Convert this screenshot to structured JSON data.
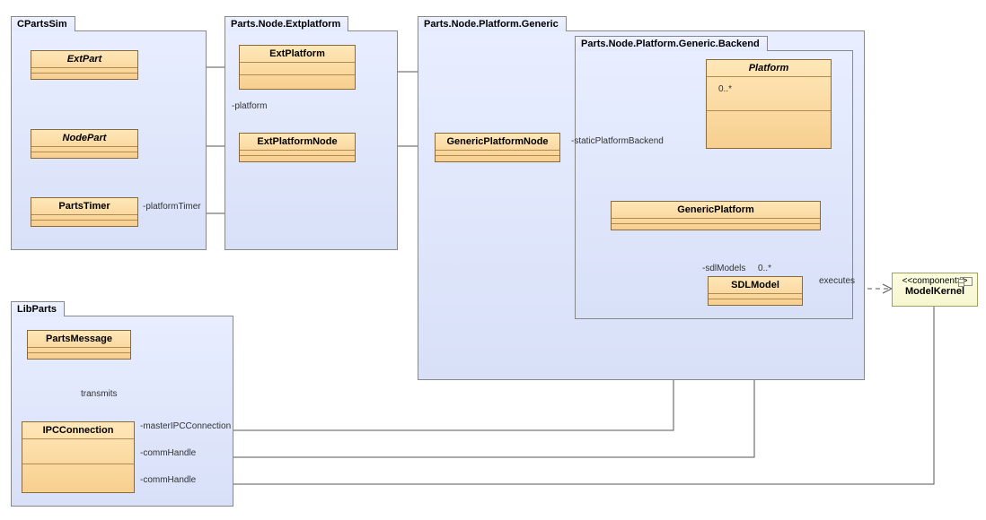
{
  "packages": {
    "cpartssim": {
      "title": "CPartsSim"
    },
    "extplatform": {
      "title": "Parts.Node.Extplatform"
    },
    "generic": {
      "title": "Parts.Node.Platform.Generic"
    },
    "backend": {
      "title": "Parts.Node.Platform.Generic.Backend"
    },
    "libparts": {
      "title": "LibParts"
    }
  },
  "classes": {
    "extpart": {
      "name": "ExtPart"
    },
    "nodepart": {
      "name": "NodePart"
    },
    "partstimer": {
      "name": "PartsTimer"
    },
    "extplatform": {
      "name": "ExtPlatform"
    },
    "extplatformnode": {
      "name": "ExtPlatformNode"
    },
    "genericplatformnode": {
      "name": "GenericPlatformNode"
    },
    "platform": {
      "name": "Platform"
    },
    "genericplatform": {
      "name": "GenericPlatform"
    },
    "sdlmodel": {
      "name": "SDLModel"
    },
    "partsmessage": {
      "name": "PartsMessage"
    },
    "ipcconnection": {
      "name": "IPCConnection"
    }
  },
  "component": {
    "modelkernel": {
      "stereotype": "<<component>>",
      "name": "ModelKernel"
    }
  },
  "labels": {
    "platform": "-platform",
    "platformTimer": "-platformTimer",
    "staticPlatformBackend": "-staticPlatformBackend",
    "mult1": "0..*",
    "sdlModels": "-sdlModels",
    "mult2": "0..*",
    "executes": "executes",
    "transmits": "transmits",
    "masterIPCConnection": "-masterIPCConnection",
    "commHandle1": "-commHandle",
    "commHandle2": "-commHandle"
  }
}
